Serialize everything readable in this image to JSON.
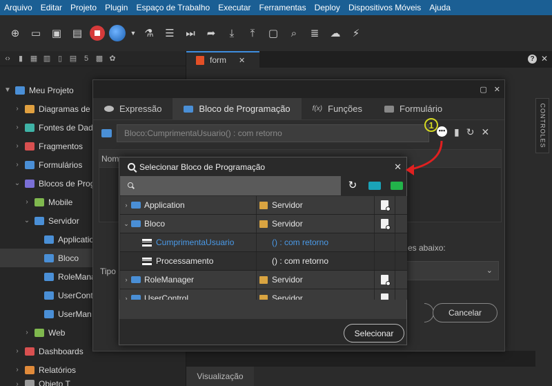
{
  "menu": [
    "Arquivo",
    "Editar",
    "Projeto",
    "Plugin",
    "Espaço de Trabalho",
    "Executar",
    "Ferramentas",
    "Deploy",
    "Dispositivos Móveis",
    "Ajuda"
  ],
  "editor_tab": {
    "label": "form",
    "close": "✕"
  },
  "tree": {
    "root": "Meu Projeto",
    "items": [
      "Diagramas de B",
      "Fontes de Dado",
      "Fragmentos",
      "Formulários",
      "Blocos de Prog",
      "Mobile",
      "Servidor",
      "Applicatio",
      "Bloco",
      "RoleManag",
      "UserCont",
      "UserMan",
      "Web",
      "Dashboards",
      "Relatórios",
      "Objeto T"
    ]
  },
  "side_panel": {
    "controles_label": "CONTROLES"
  },
  "bottom": {
    "visualizacao_tab": "Visualização"
  },
  "dialog": {
    "tabs": [
      "Expressão",
      "Bloco de Programação",
      "Funções",
      "Formulário"
    ],
    "expression_value": "Bloco:CumprimentaUsuario() : com retorno",
    "nome_label": "Nome",
    "tipo_label": "Tipo",
    "abaixo_label": "es abaixo:",
    "cancel_label": "Cancelar"
  },
  "select_dialog": {
    "title": "Selecionar Bloco de Programação",
    "search_value": "",
    "search_placeholder": "",
    "select_label": "Selecionar",
    "rows": [
      {
        "name": "Application",
        "type": "Servidor",
        "kind": "group"
      },
      {
        "name": "Bloco",
        "type": "Servidor",
        "kind": "group-open"
      },
      {
        "name": "CumprimentaUsuario",
        "type": "() : com retorno",
        "kind": "child-link"
      },
      {
        "name": "Processamento",
        "type": "() : com retorno",
        "kind": "child"
      },
      {
        "name": "RoleManager",
        "type": "Servidor",
        "kind": "group"
      },
      {
        "name": "UserControl",
        "type": "Servidor",
        "kind": "group"
      }
    ]
  },
  "annotation": {
    "number": "1",
    "color": "#d4d822",
    "arrow_color": "#e02020"
  },
  "colors": {
    "menubar": "#1b5f94",
    "link": "#4a9ae8",
    "folder": "#4a8fd6",
    "server_box": "#d9a441",
    "stop": "#d63b3b"
  }
}
